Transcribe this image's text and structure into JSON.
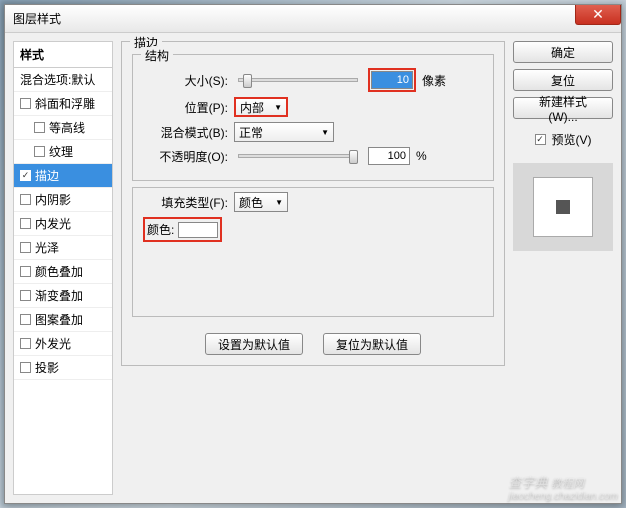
{
  "title": "图层样式",
  "sidebar": {
    "header": "样式",
    "blendDefault": "混合选项:默认",
    "items": [
      {
        "label": "斜面和浮雕",
        "checked": false,
        "indent": false,
        "selected": false
      },
      {
        "label": "等高线",
        "checked": false,
        "indent": true,
        "selected": false
      },
      {
        "label": "纹理",
        "checked": false,
        "indent": true,
        "selected": false
      },
      {
        "label": "描边",
        "checked": true,
        "indent": false,
        "selected": true
      },
      {
        "label": "内阴影",
        "checked": false,
        "indent": false,
        "selected": false
      },
      {
        "label": "内发光",
        "checked": false,
        "indent": false,
        "selected": false
      },
      {
        "label": "光泽",
        "checked": false,
        "indent": false,
        "selected": false
      },
      {
        "label": "颜色叠加",
        "checked": false,
        "indent": false,
        "selected": false
      },
      {
        "label": "渐变叠加",
        "checked": false,
        "indent": false,
        "selected": false
      },
      {
        "label": "图案叠加",
        "checked": false,
        "indent": false,
        "selected": false
      },
      {
        "label": "外发光",
        "checked": false,
        "indent": false,
        "selected": false
      },
      {
        "label": "投影",
        "checked": false,
        "indent": false,
        "selected": false
      }
    ]
  },
  "main": {
    "groupTitle": "描边",
    "structTitle": "结构",
    "sizeLabel": "大小(S):",
    "sizeValue": "10",
    "sizeUnit": "像素",
    "posLabel": "位置(P):",
    "posValue": "内部",
    "blendLabel": "混合模式(B):",
    "blendValue": "正常",
    "opacityLabel": "不透明度(O):",
    "opacityValue": "100",
    "opacityUnit": "%",
    "fillTypeLabel": "填充类型(F):",
    "fillTypeValue": "颜色",
    "colorLabel": "颜色:",
    "setDefault": "设置为默认值",
    "resetDefault": "复位为默认值"
  },
  "right": {
    "ok": "确定",
    "cancel": "复位",
    "newStyle": "新建样式(W)...",
    "previewLabel": "预览(V)"
  },
  "watermark": {
    "line1": "查字典",
    "line2": "jiaocheng.chazidian.com",
    "sub": "教程网"
  }
}
